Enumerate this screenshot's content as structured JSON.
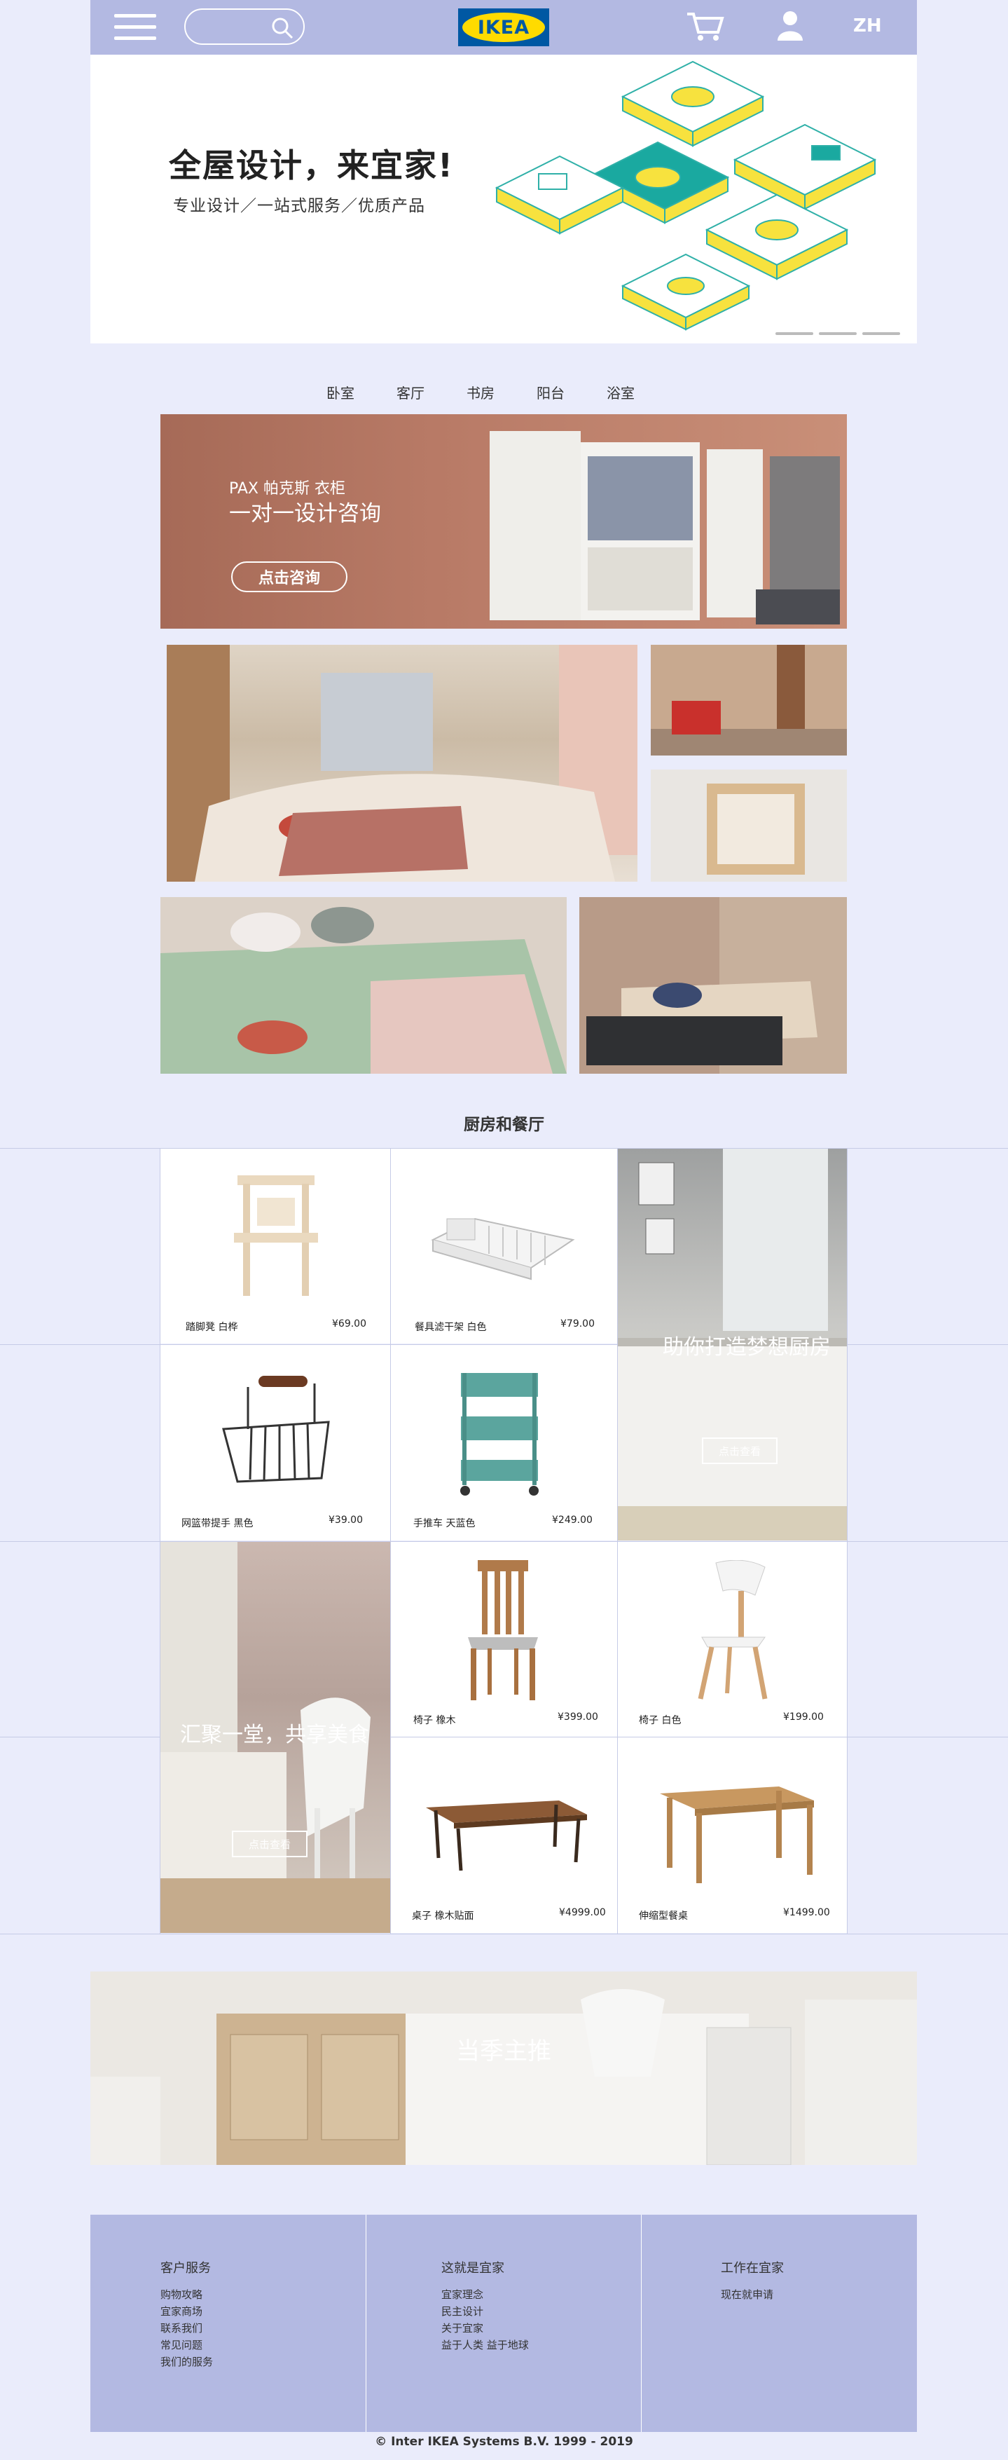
{
  "header": {
    "lang": "ZH",
    "logo_text": "IKEA",
    "brand_blue": "#0058a3",
    "brand_yellow": "#ffdb00",
    "bar_color": "#b3b9e2"
  },
  "hero": {
    "title": "全屋设计，来宜家!",
    "subtitle": "专业设计／一站式服务／优质产品"
  },
  "tabs": [
    "卧室",
    "客厅",
    "书房",
    "阳台",
    "浴室"
  ],
  "promo": {
    "small": "PAX 帕克斯 衣柜",
    "big": "一对一设计咨询",
    "button": "点击咨询"
  },
  "kitchen": {
    "title": "厨房和餐厅",
    "products": [
      {
        "name": "踏脚凳  白桦",
        "price": "¥69.00"
      },
      {
        "name": "餐具滤干架  白色",
        "price": "¥79.00"
      },
      {
        "name": "网篮带提手  黑色",
        "price": "¥39.00"
      },
      {
        "name": "手推车  天蓝色",
        "price": "¥249.00"
      },
      {
        "name": "椅子  橡木",
        "price": "¥399.00"
      },
      {
        "name": "椅子  白色",
        "price": "¥199.00"
      },
      {
        "name": "桌子  橡木贴面",
        "price": "¥4999.00"
      },
      {
        "name": "伸缩型餐桌",
        "price": "¥1499.00"
      }
    ],
    "feature1": {
      "text": "助你打造梦想厨房",
      "button": "点击查看"
    },
    "feature2": {
      "text": "汇聚一堂，共享美食",
      "button": "点击查看"
    }
  },
  "season": {
    "title": "当季主推"
  },
  "footer": {
    "columns": [
      {
        "title": "客户服务",
        "links": [
          "购物攻略",
          "宜家商场",
          "联系我们",
          "常见问题",
          "我们的服务"
        ]
      },
      {
        "title": "这就是宜家",
        "links": [
          "宜家理念",
          "民主设计",
          "关于宜家",
          "益于人类 益于地球"
        ]
      },
      {
        "title": "工作在宜家",
        "links": [
          "现在就申请"
        ]
      }
    ],
    "copyright": "© Inter IKEA Systems B.V. 1999 - 2019"
  }
}
